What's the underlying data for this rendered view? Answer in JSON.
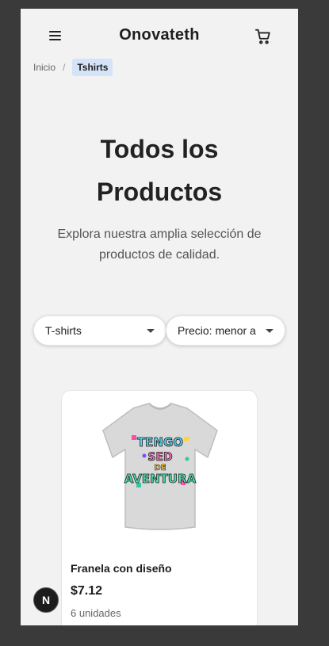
{
  "header": {
    "brand": "Onovateth",
    "menu_icon": "hamburger-menu-icon",
    "cart_icon": "shopping-cart-icon"
  },
  "breadcrumb": {
    "home": "Inicio",
    "separator": "/",
    "current": "Tshirts"
  },
  "main": {
    "title_line1": "Todos los",
    "title_line2": "Productos",
    "subtitle": "Explora nuestra amplia selección de productos de calidad."
  },
  "filters": {
    "category": {
      "selected": "T-shirts"
    },
    "sort": {
      "selected": "Precio: menor a"
    }
  },
  "products": [
    {
      "name": "Franela con diseño",
      "price": "$7.12",
      "stock": "6 unidades",
      "image_alt": "t-shirt-graphic",
      "image_text": [
        "TENGO",
        "SED",
        "DE",
        "AVENTURA"
      ]
    }
  ],
  "dev_badge": {
    "letter": "N"
  },
  "colors": {
    "page_bg": "#f2f2f2",
    "outer_bg": "#3a3a3a",
    "breadcrumb_active_bg": "#d4e3f7",
    "text_primary": "#222222"
  }
}
